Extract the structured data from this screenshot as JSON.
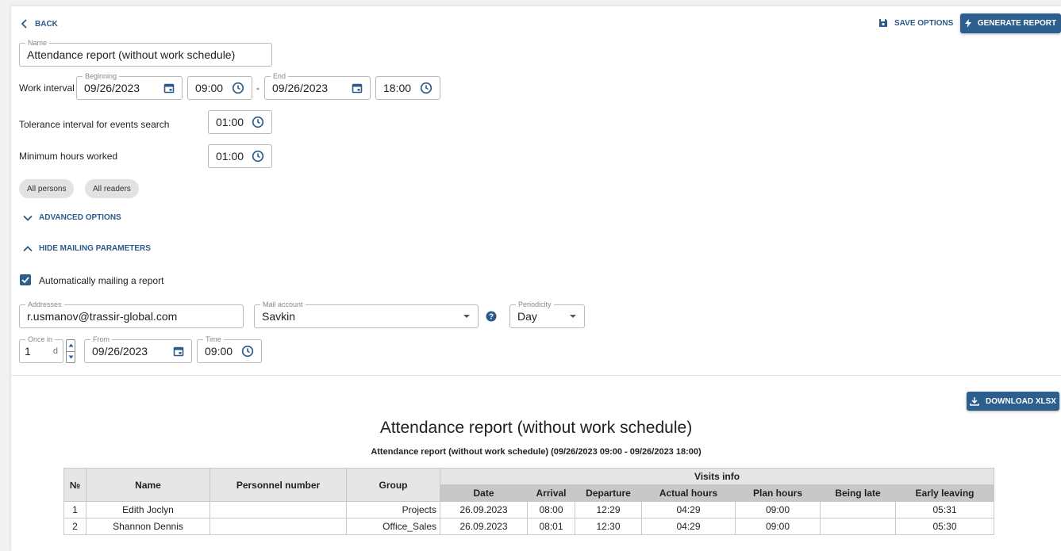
{
  "toolbar": {
    "back_label": "BACK",
    "save_label": "SAVE OPTIONS",
    "generate_label": "GENERATE REPORT"
  },
  "form": {
    "name": {
      "label": "Name",
      "value": "Attendance report (without work schedule)"
    },
    "work_interval": {
      "label": "Work interval",
      "beginning_label": "Beginning",
      "begin_date": "09/26/2023",
      "begin_time": "09:00",
      "separator": "-",
      "end_label": "End",
      "end_date": "09/26/2023",
      "end_time": "18:00"
    },
    "tolerance": {
      "label": "Tolerance interval for events search",
      "value": "01:00"
    },
    "min_hours": {
      "label": "Minimum hours worked",
      "value": "01:00"
    },
    "chips": {
      "persons": "All persons",
      "readers": "All readers"
    },
    "advanced_label": "ADVANCED OPTIONS",
    "mailing_toggle_label": "HIDE MAILING PARAMETERS",
    "auto_mail": {
      "label": "Automatically mailing a report",
      "checked": true
    },
    "addresses": {
      "label": "Addresses",
      "value": "r.usmanov@trassir-global.com"
    },
    "mail_account": {
      "label": "Mail account",
      "value": "Savkin"
    },
    "periodicity": {
      "label": "Periodicity",
      "value": "Day"
    },
    "once_in": {
      "label": "Once in",
      "value": "1",
      "unit": "d"
    },
    "from": {
      "label": "From",
      "value": "09/26/2023"
    },
    "time": {
      "label": "Time",
      "value": "09:00"
    }
  },
  "report": {
    "download_label": "DOWNLOAD XLSX",
    "title": "Attendance report (without work schedule)",
    "subtitle": "Attendance report (without work schedule) (09/26/2023 09:00 - 09/26/2023 18:00)",
    "headers": {
      "no": "№",
      "name": "Name",
      "personnel": "Personnel number",
      "group": "Group",
      "visits": "Visits info",
      "date": "Date",
      "arrival": "Arrival",
      "departure": "Departure",
      "actual": "Actual hours",
      "plan": "Plan hours",
      "late": "Being late",
      "early": "Early leaving"
    },
    "rows": [
      {
        "no": "1",
        "name": "Edith Joclyn",
        "personnel": "",
        "group": "Projects",
        "date": "26.09.2023",
        "arrival": "08:00",
        "departure": "12:29",
        "actual": "04:29",
        "plan": "09:00",
        "late": "",
        "early": "05:31"
      },
      {
        "no": "2",
        "name": "Shannon Dennis",
        "personnel": "",
        "group": "Office_Sales",
        "date": "26.09.2023",
        "arrival": "08:01",
        "departure": "12:30",
        "actual": "04:29",
        "plan": "09:00",
        "late": "",
        "early": "05:30"
      }
    ]
  },
  "colors": {
    "accent": "#2d5f8e",
    "header_bg": "#e6e6e6",
    "header_dark_bg": "#c8c8c8"
  }
}
